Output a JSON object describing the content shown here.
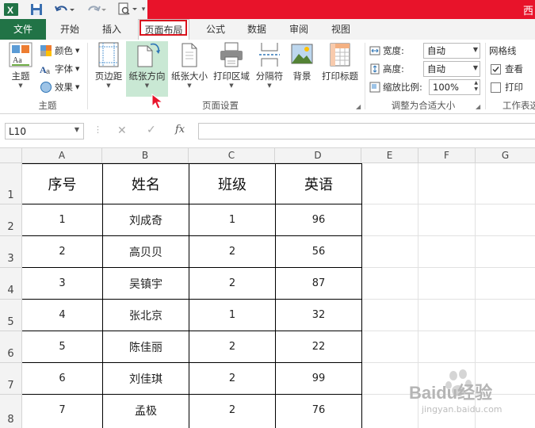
{
  "titlebar": {
    "right_char": "西"
  },
  "tabs": [
    "文件",
    "开始",
    "插入",
    "页面布局",
    "公式",
    "数据",
    "审阅",
    "视图"
  ],
  "ribbon": {
    "themes": {
      "label": "主题",
      "colors": "颜色",
      "fonts": "字体",
      "effects": "效果",
      "group": "主题"
    },
    "page_setup": {
      "margins": "页边距",
      "orientation": "纸张方向",
      "size": "纸张大小",
      "print_area": "打印区域",
      "breaks": "分隔符",
      "background": "背景",
      "print_titles": "打印标题",
      "group": "页面设置"
    },
    "scale": {
      "width_label": "宽度:",
      "width_value": "自动",
      "height_label": "高度:",
      "height_value": "自动",
      "scale_label": "缩放比例:",
      "scale_value": "100%",
      "group": "调整为合适大小"
    },
    "sheet": {
      "gridlines": "网格线",
      "view": "查看",
      "print": "打印",
      "group": "工作表选"
    }
  },
  "formula": {
    "namebox": "L10",
    "fx": "fx",
    "cancel": "✕",
    "enter": "✓"
  },
  "columns": [
    "A",
    "B",
    "C",
    "D",
    "E",
    "F",
    "G"
  ],
  "rows": [
    "1",
    "2",
    "3",
    "4",
    "5",
    "6",
    "7",
    "8"
  ],
  "table": {
    "headers": [
      "序号",
      "姓名",
      "班级",
      "英语"
    ],
    "rows": [
      [
        "1",
        "刘成奇",
        "1",
        "96"
      ],
      [
        "2",
        "高贝贝",
        "2",
        "56"
      ],
      [
        "3",
        "吴镇宇",
        "2",
        "87"
      ],
      [
        "4",
        "张北京",
        "1",
        "32"
      ],
      [
        "5",
        "陈佳丽",
        "2",
        "22"
      ],
      [
        "6",
        "刘佳琪",
        "2",
        "99"
      ],
      [
        "7",
        "孟极",
        "2",
        "76"
      ]
    ]
  },
  "watermark": {
    "text": "Baidu经验",
    "url": "jingyan.baidu.com"
  },
  "colors": {
    "excel_green": "#217346",
    "title_red": "#e8132a",
    "highlight_red": "#d9141e"
  }
}
